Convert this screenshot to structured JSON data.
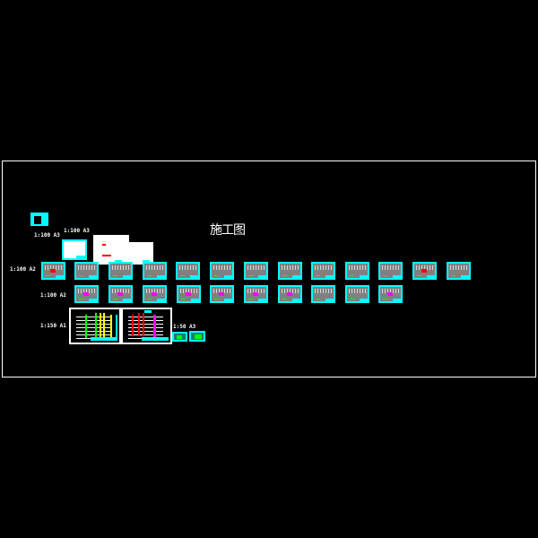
{
  "drawing": {
    "title": "施工图",
    "colors": {
      "background": "#000000",
      "frame": "#ffffff",
      "sheet_border": "#00ffff",
      "accent_magenta": "#ff00ff",
      "accent_green": "#00ff00",
      "accent_red": "#ff0000",
      "accent_yellow": "#ffff00"
    },
    "scale_labels": {
      "cover": "1:100  A3",
      "index": "1:100  A3",
      "row1": "1:100  A2",
      "row2": "1:100  A2",
      "row3": "1:150  A1",
      "detail": "1:50  A3"
    },
    "rows": {
      "row1_sheet_count": 13,
      "row2_sheet_count": 10,
      "row2_magenta_sheets": [
        0,
        1,
        2,
        3,
        4,
        5,
        6,
        9
      ],
      "row1_red_sheets": [
        0,
        11
      ]
    }
  }
}
